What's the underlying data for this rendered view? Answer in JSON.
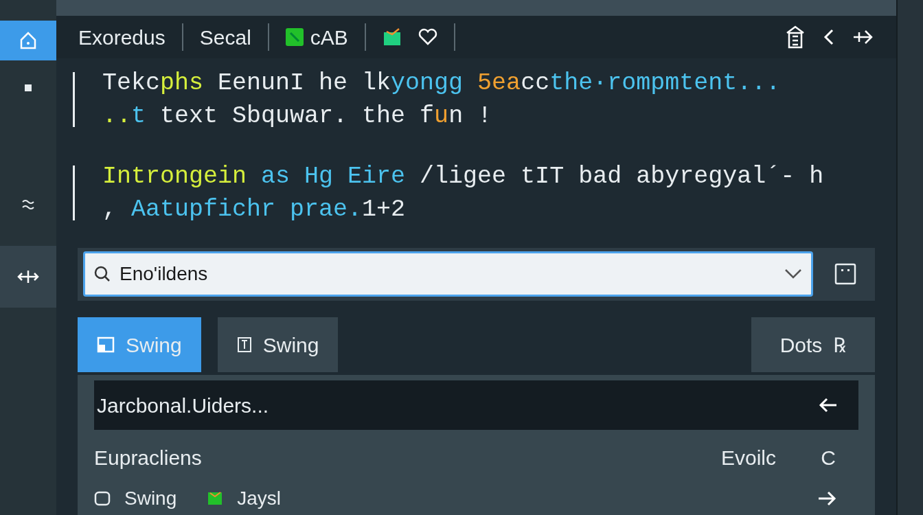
{
  "sidebar": {
    "items": [
      {
        "kind": "home",
        "selected": true
      },
      {
        "kind": "dot",
        "selected": false
      },
      {
        "kind": "wave",
        "selected": false
      },
      {
        "kind": "move",
        "selected": true
      }
    ]
  },
  "toolbar": {
    "labels": [
      "Exoredus",
      "Secal"
    ],
    "tag": "cAB"
  },
  "editor": {
    "paragraphs": [
      [
        [
          {
            "text": "Tekc",
            "color": "#e8edf0"
          },
          {
            "text": "phs",
            "color": "#d6ef3c"
          },
          {
            "text": " EenunI he lk",
            "color": "#e8edf0"
          },
          {
            "text": "yongg",
            "color": "#4cc3ef"
          },
          {
            "text": " 5ea",
            "color": "#f0a030"
          },
          {
            "text": "cc",
            "color": "#e8edf0"
          },
          {
            "text": "the·rompm",
            "color": "#4cc3ef"
          },
          {
            "text": "tent...",
            "color": "#4cc3ef"
          }
        ],
        [
          {
            "text": "..",
            "color": "#d6ef3c"
          },
          {
            "text": "t",
            "color": "#4cc3ef"
          },
          {
            "text": " text Sbquwar. the f",
            "color": "#e8edf0"
          },
          {
            "text": "u",
            "color": "#f0a030"
          },
          {
            "text": "n !",
            "color": "#e8edf0"
          }
        ]
      ],
      [
        [
          {
            "text": "Introngein",
            "color": "#d6ef3c"
          },
          {
            "text": " as Hg Eire",
            "color": "#4cc3ef"
          },
          {
            "text": " /ligee tIT bad abyregyal´- h",
            "color": "#e8edf0"
          }
        ],
        [
          {
            "text": ", ",
            "color": "#e8edf0"
          },
          {
            "text": "Aatupfichr ",
            "color": "#4cc3ef"
          },
          {
            "text": "prae.",
            "color": "#4cc3ef"
          },
          {
            "text": "1+2",
            "color": "#e8edf0"
          }
        ]
      ]
    ]
  },
  "search": {
    "value": "Eno'ildens"
  },
  "tabs": [
    {
      "label": "Swing",
      "selected": true
    },
    {
      "label": "Swing",
      "selected": false
    }
  ],
  "action": {
    "label": "Dots",
    "icon": "℞"
  },
  "list": {
    "rows": [
      {
        "text": "Jarcbonal.Uiders...",
        "selected": true
      },
      {
        "text": "Eupracliens",
        "right_text": "Evoilc",
        "right_icon": "C",
        "selected": false
      }
    ],
    "footer_items": [
      "Swing",
      "Jaysl"
    ]
  }
}
